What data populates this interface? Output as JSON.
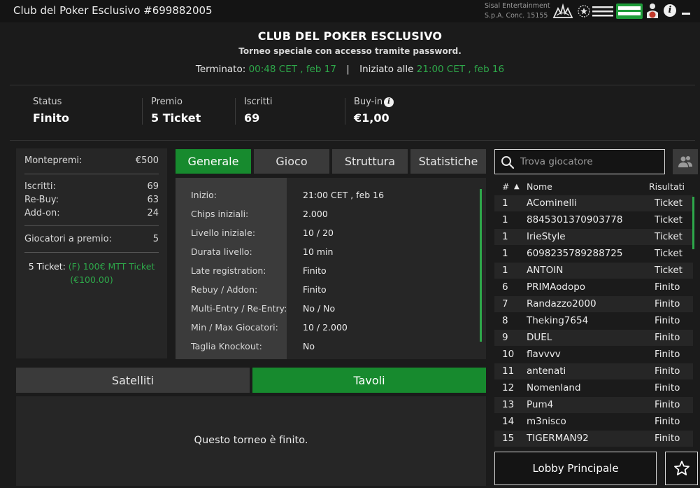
{
  "window": {
    "title": "Club del Poker Esclusivo #699882005",
    "operator_line1": "Sisal Entertainment",
    "operator_line2": "S.p.A. Conc. 15155",
    "logos": [
      "adm-logo",
      "agenzia-dogane-monopoli-logo",
      "gioca-il-giusto-logo",
      "18-plus-logo"
    ]
  },
  "header": {
    "title": "CLUB DEL POKER ESCLUSIVO",
    "subtitle": "Torneo speciale con accesso tramite password.",
    "ended_label": "Terminato:",
    "ended_value": "00:48 CET , feb 17",
    "separator": "|",
    "started_label": "Iniziato alle",
    "started_value": "21:00 CET , feb 16"
  },
  "stats": [
    {
      "label": "Status",
      "value": "Finito"
    },
    {
      "label": "Premio",
      "value": "5 Ticket"
    },
    {
      "label": "Iscritti",
      "value": "69"
    },
    {
      "label": "Buy-in",
      "value": "€1,00"
    }
  ],
  "prize_panel": {
    "montepremi_label": "Montepremi:",
    "montepremi_value": "€500",
    "iscritti_label": "Iscritti:",
    "iscritti_value": "69",
    "rebuy_label": "Re-Buy:",
    "rebuy_value": "63",
    "addon_label": "Add-on:",
    "addon_value": "24",
    "giocatori_label": "Giocatori a premio:",
    "giocatori_value": "5",
    "ticket_prefix": "5 Ticket:",
    "ticket_name": "(F) 100€ MTT Ticket",
    "ticket_value": "(€100.00)"
  },
  "tabs": [
    "Generale",
    "Gioco",
    "Struttura",
    "Statistiche"
  ],
  "details": [
    {
      "label": "Inizio:",
      "value": "21:00 CET , feb 16"
    },
    {
      "label": "Chips iniziali:",
      "value": "2.000"
    },
    {
      "label": "Livello iniziale:",
      "value": "10 / 20"
    },
    {
      "label": "Durata livello:",
      "value": "10 min"
    },
    {
      "label": "Late registration:",
      "value": "Finito"
    },
    {
      "label": "Rebuy / Addon:",
      "value": "Finito"
    },
    {
      "label": "Multi-Entry / Re-Entry:",
      "value": "No / No"
    },
    {
      "label": "Min / Max Giocatori:",
      "value": "10 / 2.000"
    },
    {
      "label": "Taglia Knockout:",
      "value": "No"
    }
  ],
  "bottom_tabs": {
    "satelliti": "Satelliti",
    "tavoli": "Tavoli"
  },
  "finished_message": "Questo torneo è finito.",
  "search": {
    "placeholder": "Trova giocatore"
  },
  "players_header": {
    "rank": "#",
    "sort": "▲",
    "name": "Nome",
    "result": "Risultati"
  },
  "players": [
    {
      "rank": "1",
      "name": "ACominelli",
      "result": "Ticket"
    },
    {
      "rank": "1",
      "name": "8845301370903778",
      "result": "Ticket"
    },
    {
      "rank": "1",
      "name": "IrieStyle",
      "result": "Ticket"
    },
    {
      "rank": "1",
      "name": "6098235789288725",
      "result": "Ticket"
    },
    {
      "rank": "1",
      "name": "ANTOIN",
      "result": "Ticket"
    },
    {
      "rank": "6",
      "name": "PRIMAodopo",
      "result": "Finito"
    },
    {
      "rank": "7",
      "name": "Randazzo2000",
      "result": "Finito"
    },
    {
      "rank": "8",
      "name": "Theking7654",
      "result": "Finito"
    },
    {
      "rank": "9",
      "name": "DUEL",
      "result": "Finito"
    },
    {
      "rank": "10",
      "name": "flavvvv",
      "result": "Finito"
    },
    {
      "rank": "11",
      "name": "antenati",
      "result": "Finito"
    },
    {
      "rank": "12",
      "name": "Nomenland",
      "result": "Finito"
    },
    {
      "rank": "13",
      "name": "Pum4",
      "result": "Finito"
    },
    {
      "rank": "14",
      "name": "m3nisco",
      "result": "Finito"
    },
    {
      "rank": "15",
      "name": "TIGERMAN92",
      "result": "Finito"
    }
  ],
  "lobby_button": "Lobby Principale",
  "colors": {
    "accent_green": "#178a2e",
    "text_green": "#2ea84a",
    "background": "#1b1b1b",
    "panel": "#262626"
  }
}
